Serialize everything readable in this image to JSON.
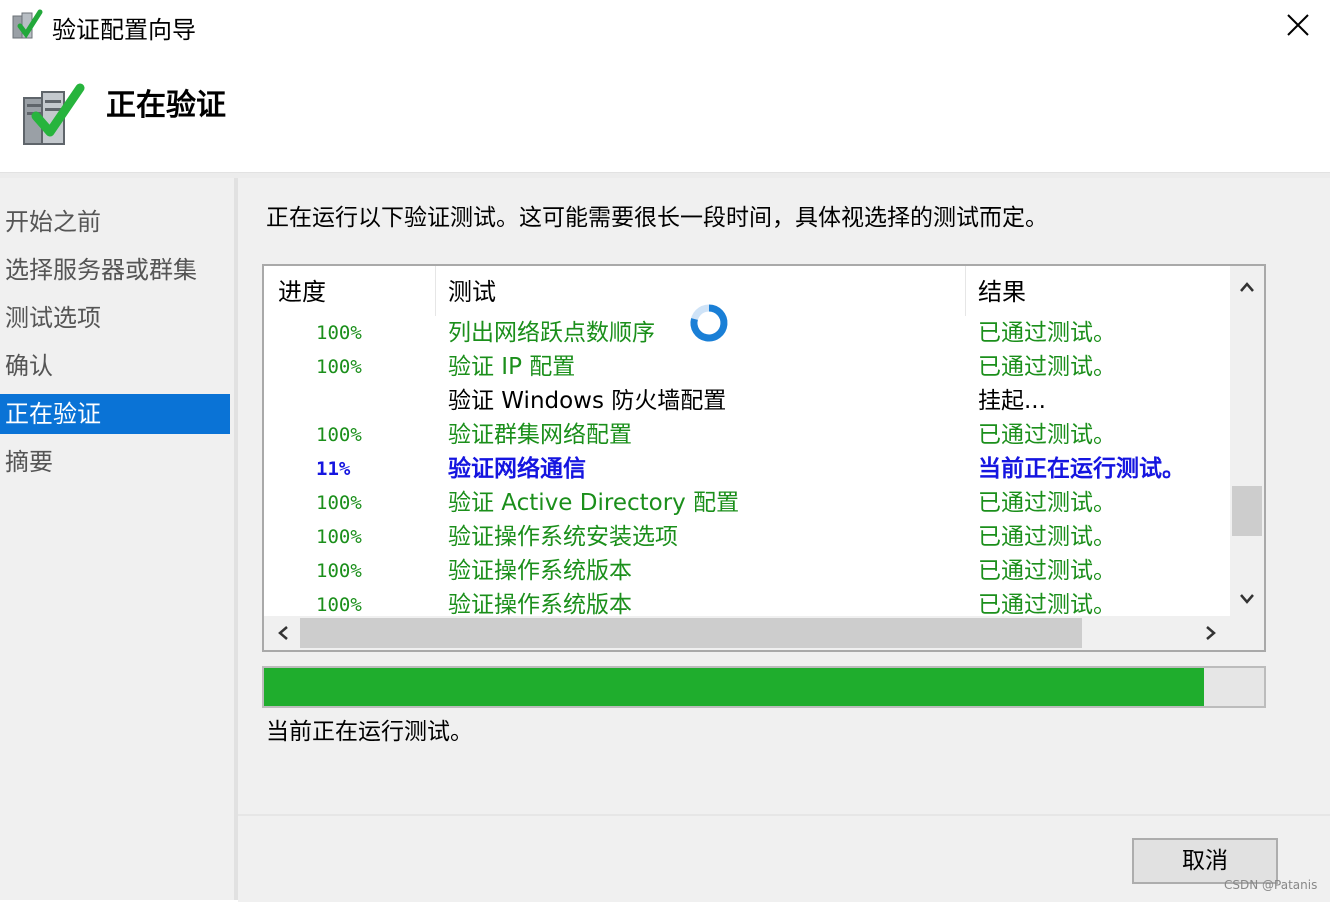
{
  "window": {
    "title": "验证配置向导",
    "close_icon": "close-icon"
  },
  "header": {
    "title": "正在验证",
    "icon": "server-check-icon"
  },
  "sidebar": {
    "items": [
      {
        "label": "开始之前",
        "active": false
      },
      {
        "label": "选择服务器或群集",
        "active": false
      },
      {
        "label": "测试选项",
        "active": false
      },
      {
        "label": "确认",
        "active": false
      },
      {
        "label": "正在验证",
        "active": true
      },
      {
        "label": "摘要",
        "active": false
      }
    ]
  },
  "main": {
    "description": "正在运行以下验证测试。这可能需要很长一段时间，具体视选择的测试而定。",
    "columns": {
      "progress": "进度",
      "test": "测试",
      "result": "结果"
    },
    "rows": [
      {
        "progress": "100%",
        "test": "列出网络跃点数顺序",
        "result": "已通过测试。",
        "state": "passed"
      },
      {
        "progress": "100%",
        "test": "验证 IP 配置",
        "result": "已通过测试。",
        "state": "passed"
      },
      {
        "progress": "",
        "test": "验证 Windows 防火墙配置",
        "result": "挂起...",
        "state": "pending"
      },
      {
        "progress": "100%",
        "test": "验证群集网络配置",
        "result": "已通过测试。",
        "state": "passed"
      },
      {
        "progress": "11%",
        "test": "验证网络通信",
        "result": "当前正在运行测试。",
        "state": "running"
      },
      {
        "progress": "100%",
        "test": "验证 Active Directory 配置",
        "result": "已通过测试。",
        "state": "passed"
      },
      {
        "progress": "100%",
        "test": "验证操作系统安装选项",
        "result": "已通过测试。",
        "state": "passed"
      },
      {
        "progress": "100%",
        "test": "验证操作系统版本",
        "result": "已通过测试。",
        "state": "passed"
      },
      {
        "progress": "100%",
        "test": "验证操作系统版本",
        "result": "已通过测试。",
        "state": "passed"
      }
    ],
    "overall_progress_fraction": 0.94,
    "status_text": "当前正在运行测试。"
  },
  "footer": {
    "cancel_label": "取消"
  },
  "watermark": "CSDN @Patanis",
  "colors": {
    "passed": "#1b8f1b",
    "pending": "#000000",
    "running": "#1515e0",
    "progress_fill": "#1fad2d",
    "active_nav": "#0a73d6"
  }
}
